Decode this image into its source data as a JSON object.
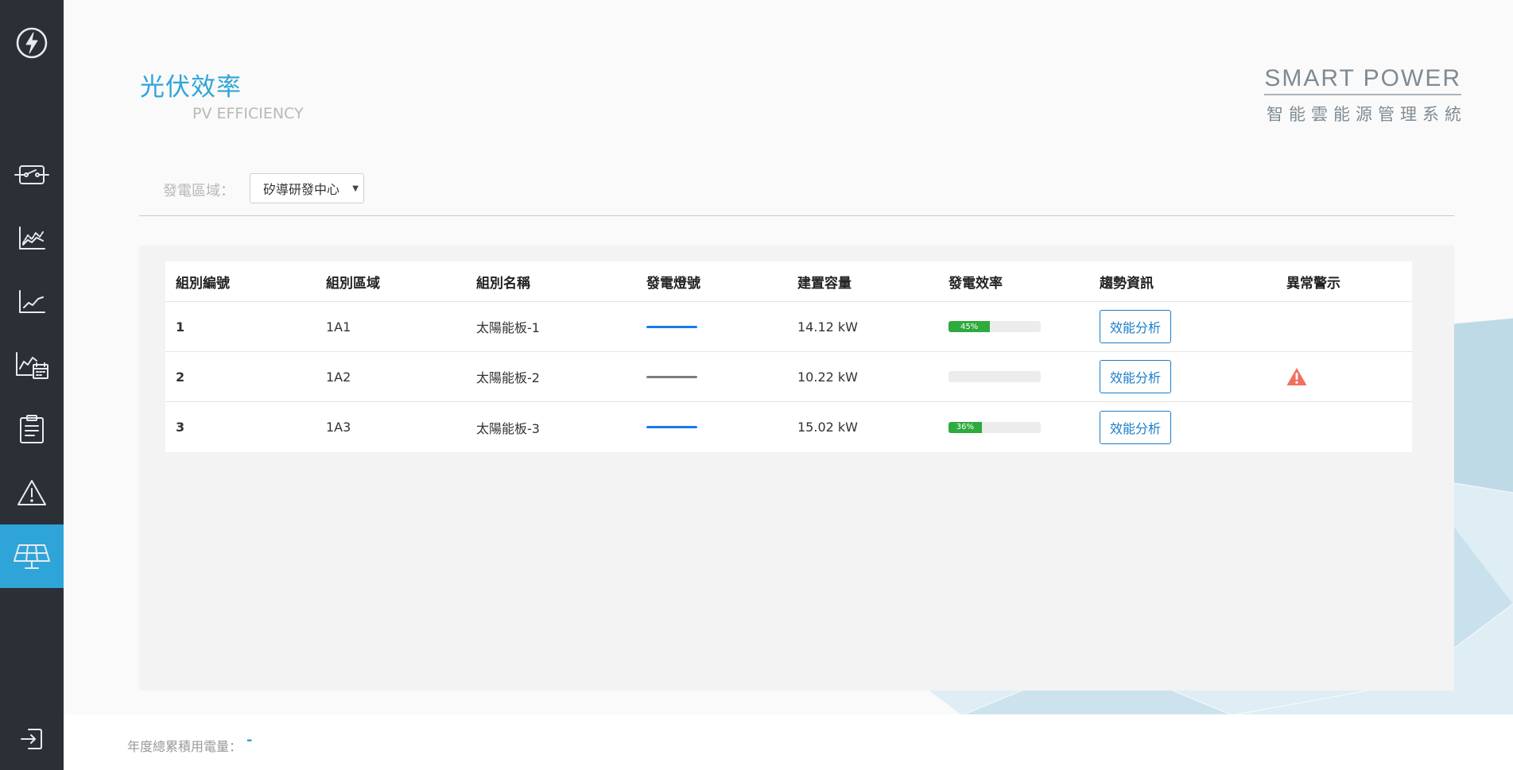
{
  "page": {
    "title_zh": "光伏效率",
    "title_en": "PV EFFICIENCY"
  },
  "brand": {
    "en": "SMART POWER",
    "zh": "智能雲能源管理系統"
  },
  "filter": {
    "label": "發電區域：",
    "selected": "矽導研發中心"
  },
  "sidebar": {
    "items": [
      {
        "icon": "switch-icon"
      },
      {
        "icon": "trend-chart-icon"
      },
      {
        "icon": "line-chart-icon"
      },
      {
        "icon": "chart-calendar-icon"
      },
      {
        "icon": "clipboard-icon"
      },
      {
        "icon": "warning-icon"
      },
      {
        "icon": "solar-panel-icon",
        "active": true
      }
    ],
    "logout_icon": "logout-icon"
  },
  "table": {
    "headers": [
      "組別編號",
      "組別區域",
      "組別名稱",
      "發電燈號",
      "建置容量",
      "發電效率",
      "趨勢資訊",
      "異常警示"
    ],
    "rows": [
      {
        "id": "1",
        "area": "1A1",
        "name": "太陽能板-1",
        "light_color": "#1a7be6",
        "capacity": "14.12 kW",
        "efficiency": 45,
        "efficiency_label": "45%",
        "trend_button": "效能分析",
        "alert": false
      },
      {
        "id": "2",
        "area": "1A2",
        "name": "太陽能板-2",
        "light_color": "#7d7d7d",
        "capacity": "10.22 kW",
        "efficiency": 0,
        "efficiency_label": "",
        "trend_button": "效能分析",
        "alert": true
      },
      {
        "id": "3",
        "area": "1A3",
        "name": "太陽能板-3",
        "light_color": "#1a7be6",
        "capacity": "15.02 kW",
        "efficiency": 36,
        "efficiency_label": "36%",
        "trend_button": "效能分析",
        "alert": false
      }
    ]
  },
  "footer": {
    "label": "年度總累積用電量：",
    "value": "-"
  },
  "colors": {
    "accent": "#2fa4d8",
    "sidebar_bg": "#2b2f36",
    "progress_fill": "#2eaa3e",
    "alert": "#f0705f"
  }
}
